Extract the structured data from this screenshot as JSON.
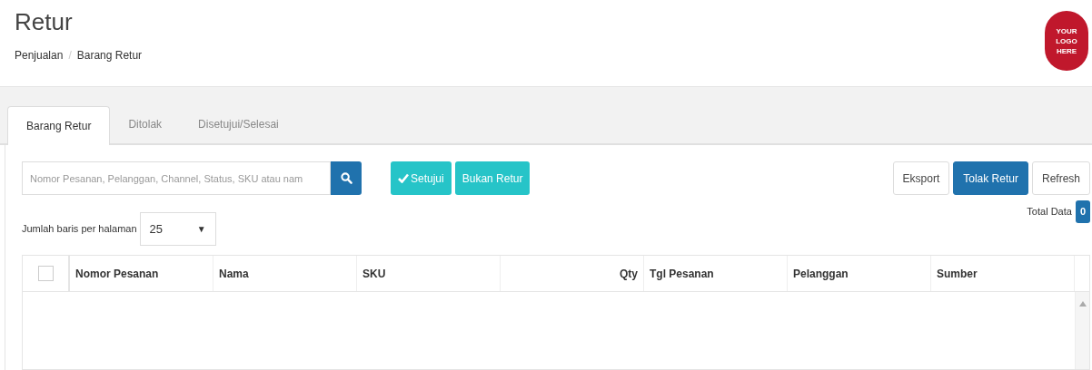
{
  "page": {
    "title": "Retur",
    "breadcrumb": [
      "Penjualan",
      "Barang Retur"
    ],
    "breadcrumb_separator": "/",
    "logo": [
      "YOUR",
      "LOGO",
      "HERE"
    ]
  },
  "tabs": [
    {
      "label": "Barang Retur",
      "selected": true
    },
    {
      "label": "Ditolak",
      "selected": false
    },
    {
      "label": "Disetujui/Selesai",
      "selected": false
    }
  ],
  "search": {
    "placeholder": "Nomor Pesanan, Pelanggan, Channel, Status, SKU atau nam"
  },
  "actions": [
    {
      "label": "Setujui",
      "kind": "approve"
    },
    {
      "label": "Bukan Retur",
      "kind": "plain"
    }
  ],
  "right_buttons": [
    {
      "label": "Eksport",
      "kind": "default"
    },
    {
      "label": "Tolak Retur",
      "kind": "primary"
    },
    {
      "label": "Refresh",
      "kind": "default"
    }
  ],
  "page_size": {
    "label": "Jumlah baris per halaman",
    "value": "25",
    "caret": "▼"
  },
  "total": {
    "label": "Total Data",
    "count": "0"
  },
  "table": {
    "select_all": {
      "checked": false
    },
    "columns": [
      {
        "label": "Nomor Pesanan",
        "kind": "text"
      },
      {
        "label": "Nama",
        "kind": "text"
      },
      {
        "label": "SKU",
        "kind": "text"
      },
      {
        "label": "Qty",
        "kind": "number"
      },
      {
        "label": "Tgl Pesanan",
        "kind": "text"
      },
      {
        "label": "Pelanggan",
        "kind": "text"
      },
      {
        "label": "Sumber",
        "kind": "text"
      }
    ]
  }
}
